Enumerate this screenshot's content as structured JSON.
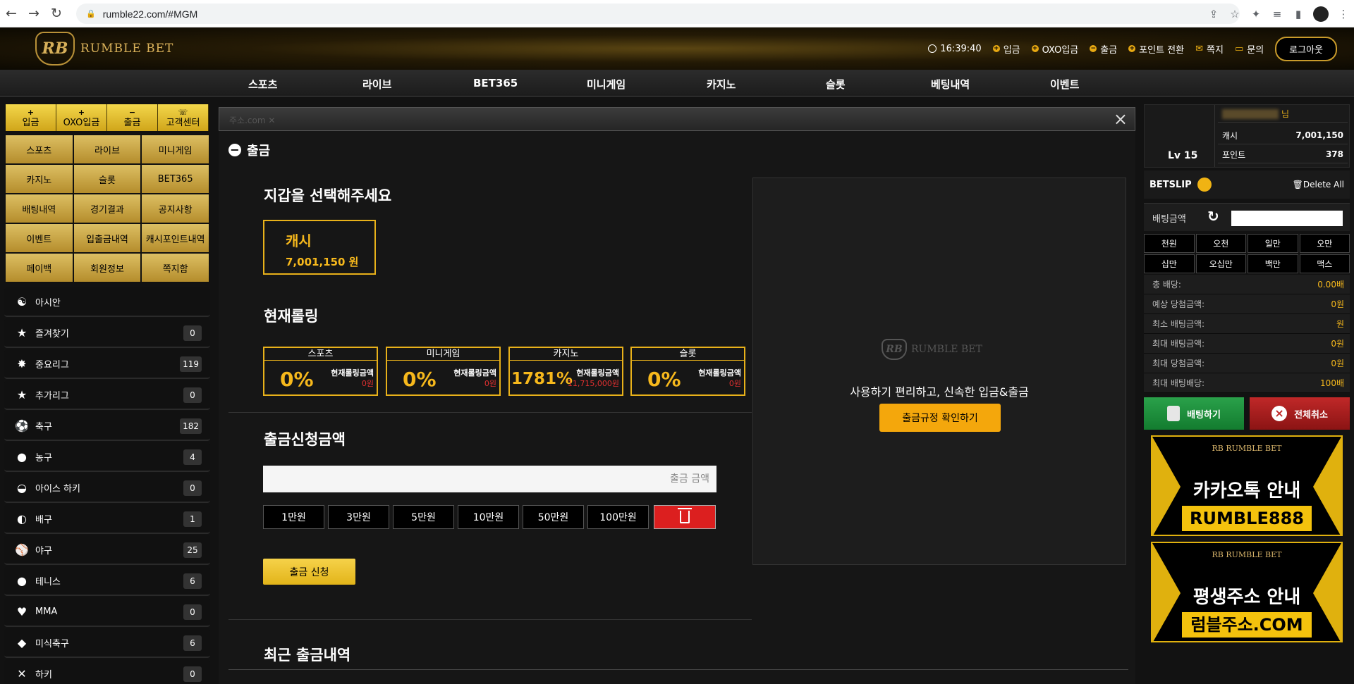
{
  "browser": {
    "url": "rumble22.com/#MGM"
  },
  "header": {
    "logo_text": "RUMBLE BET",
    "logo_badge": "RB",
    "time": "16:39:40",
    "links": [
      "입금",
      "OXO입금",
      "출금",
      "포인트 전환",
      "쪽지",
      "문의"
    ],
    "logout": "로그아웃"
  },
  "nav": [
    "스포츠",
    "라이브",
    "BET365",
    "미니게임",
    "카지노",
    "슬롯",
    "베팅내역",
    "이벤트"
  ],
  "quick": [
    {
      "icon": "+",
      "label": "입금"
    },
    {
      "icon": "+",
      "label": "OXO입금"
    },
    {
      "icon": "−",
      "label": "출금"
    },
    {
      "icon": "☏",
      "label": "고객센터"
    }
  ],
  "grid_menu": [
    "스포츠",
    "라이브",
    "미니게임",
    "카지노",
    "슬롯",
    "BET365",
    "배팅내역",
    "경기결과",
    "공지사항",
    "이벤트",
    "입출금내역",
    "캐시포인트내역",
    "페이백",
    "회원정보",
    "쪽지함"
  ],
  "sports": [
    {
      "name": "아시안",
      "count": "",
      "icon": "☯"
    },
    {
      "name": "즐겨찾기",
      "count": "0",
      "icon": "★"
    },
    {
      "name": "중요리그",
      "count": "119",
      "icon": "✸"
    },
    {
      "name": "추가리그",
      "count": "0",
      "icon": "★"
    },
    {
      "name": "축구",
      "count": "182",
      "icon": "⚽"
    },
    {
      "name": "농구",
      "count": "4",
      "icon": "●"
    },
    {
      "name": "아이스 하키",
      "count": "0",
      "icon": "◒"
    },
    {
      "name": "배구",
      "count": "1",
      "icon": "◐"
    },
    {
      "name": "야구",
      "count": "25",
      "icon": "⚾"
    },
    {
      "name": "테니스",
      "count": "6",
      "icon": "●"
    },
    {
      "name": "MMA",
      "count": "0",
      "icon": "♥"
    },
    {
      "name": "미식축구",
      "count": "6",
      "icon": "◆"
    },
    {
      "name": "하키",
      "count": "0",
      "icon": "✕"
    }
  ],
  "notice": "주소.com ✕",
  "page": {
    "title": "출금",
    "wallet_heading": "지갑을 선택해주세요",
    "wallet": {
      "label": "캐시",
      "value": "7,001,150 원"
    },
    "rolling_heading": "현재롤링",
    "rolling": [
      {
        "name": "스포츠",
        "pct": "0%",
        "label": "현재롤링금액",
        "value": "0원"
      },
      {
        "name": "미니게임",
        "pct": "0%",
        "label": "현재롤링금액",
        "value": "0원"
      },
      {
        "name": "카지노",
        "pct": "1781%",
        "label": "현재롤링금액",
        "value": "11,715,000원"
      },
      {
        "name": "슬롯",
        "pct": "0%",
        "label": "현재롤링금액",
        "value": "0원"
      }
    ],
    "amount_heading": "출금신청금액",
    "amount_placeholder": "출금 금액",
    "quick_amounts": [
      "1만원",
      "3만원",
      "5만원",
      "10만원",
      "50만원",
      "100만원"
    ],
    "submit": "출금 신청",
    "recent_heading": "최근 출금내역"
  },
  "promo": {
    "logo": "RUMBLE BET",
    "text": "사용하기 편리하고, 신속한 입금&출금",
    "button": "출금규정 확인하기"
  },
  "user": {
    "level": "Lv 15",
    "suffix": "님",
    "cash_label": "캐시",
    "cash": "7,001,150",
    "point_label": "포인트",
    "point": "378"
  },
  "betslip": {
    "title": "BETSLIP",
    "delete_all": "Delete All",
    "amount_label": "배팅금액",
    "chips": [
      "천원",
      "오천",
      "일만",
      "오만",
      "십만",
      "오십만",
      "백만",
      "맥스"
    ],
    "stats": [
      {
        "label": "총 배당:",
        "value": "0.00배"
      },
      {
        "label": "예상 당첨금액:",
        "value": "0원"
      },
      {
        "label": "최소 배팅금액:",
        "value": "원"
      },
      {
        "label": "최대 배팅금액:",
        "value": "0원"
      },
      {
        "label": "최대 당첨금액:",
        "value": "0원"
      },
      {
        "label": "최대 배팅배당:",
        "value": "100배"
      }
    ],
    "bet_button": "배팅하기",
    "cancel_button": "전체취소"
  },
  "banners": [
    {
      "logo": "RB RUMBLE BET",
      "title": "카카오톡 안내",
      "box": "RUMBLE888"
    },
    {
      "logo": "RB RUMBLE BET",
      "title": "평생주소 안내",
      "box": "럼블주소.COM"
    }
  ],
  "colors": {
    "gold": "#f6b81c",
    "accent_red": "#dc1f1f",
    "bet_green": "#1f8f3c"
  }
}
